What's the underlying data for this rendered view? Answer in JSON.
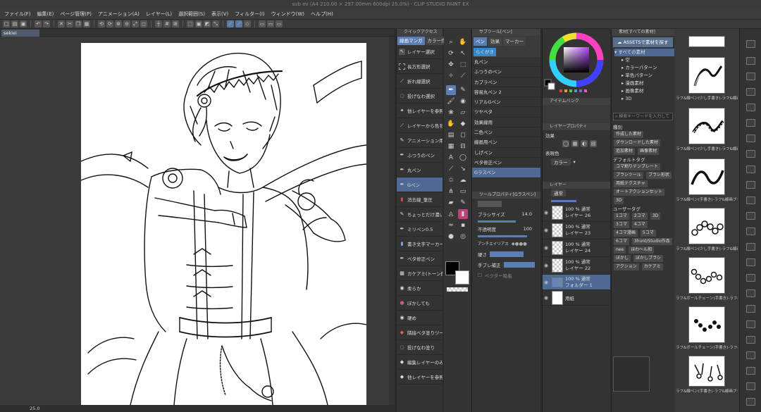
{
  "window": {
    "title": "sub ev (A4 210.00 × 297.00mm 600dpi 25.0%) - CLIP STUDIO PAINT EX"
  },
  "menu": [
    "ファイル(F)",
    "編集(E)",
    "ページ管理(P)",
    "アニメーション(A)",
    "レイヤー(L)",
    "選択範囲(S)",
    "表示(V)",
    "フィルター(I)",
    "ウィンドウ(W)",
    "ヘルプ(H)"
  ],
  "doc_tab": "sekiei",
  "status": {
    "zoom": "25.0"
  },
  "quick_access": {
    "title": "クイックアクセス",
    "tabs": [
      "線画マンガ",
      "カラー作業"
    ],
    "items": [
      {
        "label": "レイヤー選択"
      },
      {
        "label": "長方形選択"
      },
      {
        "label": "折れ線選択"
      },
      {
        "label": "投げなわ選択"
      },
      {
        "label": "他レイヤーを参照選択"
      },
      {
        "label": "レイヤーから色を取得"
      },
      {
        "label": "アニメーション用鉛筆(濃い)"
      },
      {
        "label": "ふつうのペン"
      },
      {
        "label": "丸ペン"
      },
      {
        "label": "Gペン",
        "selected": true
      },
      {
        "label": "消去線_筆圧"
      },
      {
        "label": "ちょっとだけ濃いめ"
      },
      {
        "label": "ミリペン0.5"
      },
      {
        "label": "書き文字マーカー"
      },
      {
        "label": "ベタ修正ペン"
      },
      {
        "label": "カケアミ(トーン削り用)"
      },
      {
        "label": "柔らか"
      },
      {
        "label": "ぼかしても"
      },
      {
        "label": "硬め"
      },
      {
        "label": "隣接ベタ塗りツール"
      },
      {
        "label": "投げなわ塗り"
      },
      {
        "label": "編集レイヤーのみ参照"
      },
      {
        "label": "他レイヤーを参照"
      }
    ]
  },
  "sub_tool": {
    "title": "サブツール[ペン]",
    "tabs": [
      "ペン",
      "効果",
      "マーカー",
      "Gペン"
    ],
    "section": "らくがき",
    "brushes": [
      "丸ペン",
      "ふつうのペン",
      "カブラペン",
      "容易丸ペン 2",
      "リアルGペン",
      "ツヤベタ",
      "効果線用",
      "二色ペン",
      "線画用ペン",
      "しげペン",
      "ベタ修正ペン",
      "Gラスペン"
    ],
    "selected": "Gラスペン"
  },
  "tool_property": {
    "title": "ツールプロパティ[Gラスペン]",
    "name": "Gラスペン",
    "brush_size_label": "ブラシサイズ",
    "brush_size": "14.0",
    "opacity_label": "不透明度",
    "opacity": "100",
    "antialias_label": "アンチエイリアス",
    "hardness_label": "硬さ",
    "stabilization_label": "手ブレ補正",
    "vector_label": "ベクター吸着"
  },
  "colors": {
    "main": "#000000",
    "sub": "#ffffff",
    "accent": "#5b7fb5"
  },
  "layer_panel": {
    "item_bank": "アイテムバンク",
    "layer_property_title": "レイヤープロパティ",
    "effect_label": "効果",
    "expression_label": "表現色",
    "expression_value": "カラー",
    "layer_title": "レイヤー",
    "blend_mode": "通常",
    "layers": [
      {
        "opacity": "100 %",
        "mode": "通常",
        "name": "レイヤー 26"
      },
      {
        "opacity": "100 %",
        "mode": "通常",
        "name": "レイヤー 23"
      },
      {
        "opacity": "100 %",
        "mode": "通常",
        "name": "レイヤー 24"
      },
      {
        "opacity": "100 %",
        "mode": "通常",
        "name": "レイヤー 22"
      },
      {
        "opacity": "100 %",
        "mode": "通常",
        "name": "フォルダー 1",
        "folder": true,
        "selected": true
      },
      {
        "opacity": "",
        "mode": "",
        "name": "用紙",
        "paper": true
      }
    ]
  },
  "materials": {
    "title": "素材[すべての素材]",
    "assets_button": "ASSETSで素材を探す",
    "tree": [
      "すべての素材",
      "空",
      "カラーパターン",
      "単色パターン",
      "漫画素材",
      "画像素材",
      "3D"
    ],
    "search_placeholder": "検索キーワードを入力して",
    "tags_title": "種別",
    "tags1": [
      "作成した素材",
      "ダウンロードした素材",
      "追加素材",
      "画像素材"
    ],
    "default_tags_title": "デフォルトタグ",
    "tags2": [
      "コマ割りテンプレート",
      "ブラシツール",
      "ブラシ形状",
      "用紙テクスチャ",
      "オートアクションセット",
      "3D"
    ],
    "user_tags_title": "ユーザータグ",
    "tags3": [
      "1コマ",
      "2コマ",
      "3D",
      "3コマ",
      "4コマ",
      "4コマ漫画",
      "5コマ",
      "6コマ",
      "3hunt/Studio作品",
      "nee",
      "ほわ～ん和",
      "ぼかし",
      "ぼかしブラシ",
      "アクション",
      "カケアミ"
    ]
  },
  "brush_previews": [
    "ラフ&線ペン(少し手書き)-ラフ&線画ブラシ",
    "ラフ&線ペン(少し手書き)-ラフ&線画ブラシ",
    "ラフ&線ペン(手書き)-ラフ&線画ブラシ",
    "ラフ&線ペン(少し手書き)-ラフ&線画ブラシ",
    "ラフ&ボールチェーン(手書き)-ラフ&線画",
    "ラフ&ボールチェーン(手書き)-ラフ&線画",
    "ラフ&線ペン(手書き)-ラフ&線画ブラシ"
  ]
}
